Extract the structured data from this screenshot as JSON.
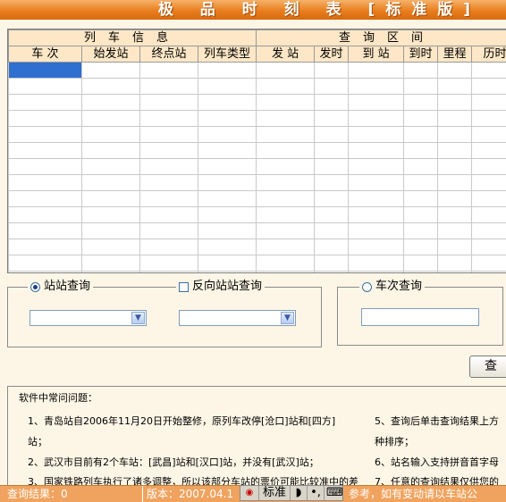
{
  "window": {
    "title": "极 品 时 刻 表 [标准版]"
  },
  "grid": {
    "group_left": "列车信息",
    "group_right": "查询区间",
    "columns": [
      "车 次",
      "始发站",
      "终点站",
      "列车类型",
      "发 站",
      "发时",
      "到 站",
      "到时",
      "里程",
      "历时"
    ]
  },
  "station_query": {
    "label": "站站查询",
    "selected": true
  },
  "reverse_query": {
    "label": "反向站站查询",
    "checked": false
  },
  "train_query": {
    "label": "车次查询",
    "selected": false
  },
  "query_button": {
    "label": "查"
  },
  "faq": {
    "title": "软件中常问问题：",
    "items": [
      "1、青岛站自2006年11月20日开始整修，原列车改停[沧口]站和[四方]",
      "站；",
      "2、武汉市目前有2个车站：[武昌]站和[汉口]站，并没有[武汉]站；",
      "3、国家铁路列车执行了诸多调整，所以该部分车站的票价可能比较准中的差"
    ],
    "right_items": [
      "5、查询后单击查询结果上方",
      "种排序；",
      "6、站名输入支持拼音首字母",
      "7、任意的查询结果仅供您的"
    ]
  },
  "status": {
    "result": "查询结果：0",
    "version": "版本：2007.04.1",
    "note": "参考，如有变动请以车站公"
  },
  "ime": {
    "mode": "标准"
  }
}
